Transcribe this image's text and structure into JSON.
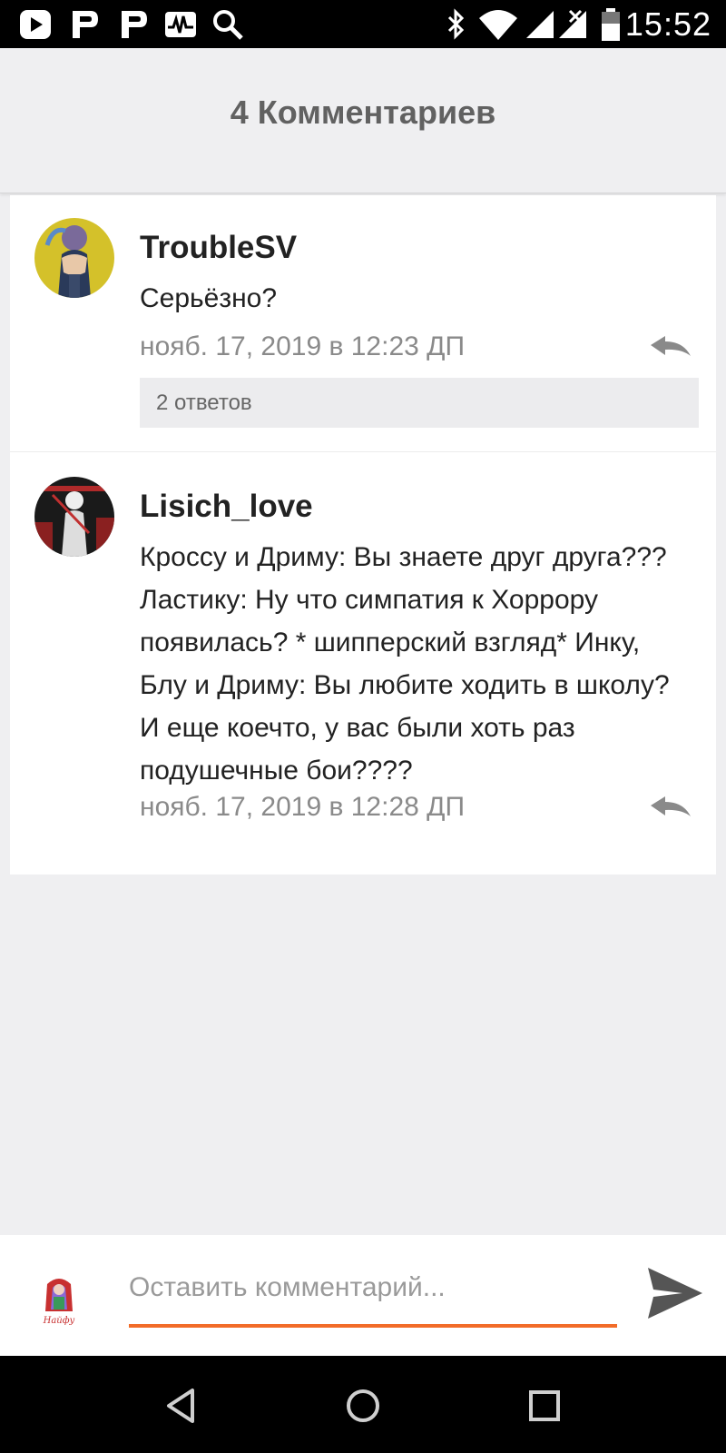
{
  "status_bar": {
    "time": "15:52",
    "left_icons": [
      "play-store-icon",
      "pixiv-icon",
      "pixiv-icon",
      "activity-icon",
      "search-icon"
    ],
    "right_icons": [
      "bluetooth-icon",
      "wifi-icon",
      "cellular-signal-icon",
      "no-sim-signal-icon",
      "battery-icon"
    ]
  },
  "header": {
    "title": "4 Комментариев"
  },
  "comments": [
    {
      "author": "TroubleSV",
      "text": "Серьёзно?",
      "date": "нояб. 17, 2019 в 12:23 ДП",
      "replies_label": "2 ответов"
    },
    {
      "author": "Lisich_love",
      "text": "Кроссу и Дриму: Вы знаете друг друга???\nЛастику: Ну что симпатия к Хоррору\nпоявилась? * шипперский взгляд*   Инку,\nБлу и Дриму: Вы любите ходить в школу?\nИ еще коечто, у вас были хоть раз\nподушечные бои????",
      "date": "нояб. 17, 2019 в 12:28 ДП"
    }
  ],
  "comment_input": {
    "placeholder": "Оставить комментарий...",
    "value": "",
    "avatar_caption": "Найфу"
  },
  "colors": {
    "accent": "#f26c29",
    "background": "#efeff1",
    "text_primary": "#222222",
    "text_secondary": "#8a8a8a"
  },
  "nav_bar": {
    "icons": [
      "back-icon",
      "home-icon",
      "recents-icon"
    ]
  }
}
